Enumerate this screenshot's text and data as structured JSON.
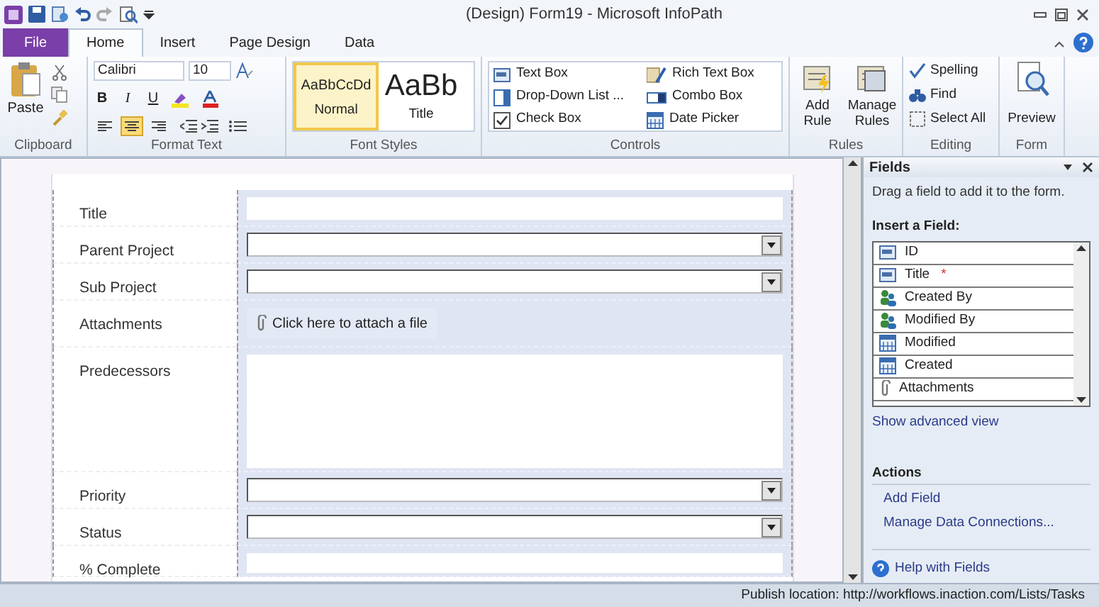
{
  "window": {
    "title": "(Design) Form19  -  Microsoft InfoPath"
  },
  "tabs": [
    {
      "label": "File",
      "kind": "file",
      "selected": false
    },
    {
      "label": "Home",
      "kind": "tab",
      "selected": true
    },
    {
      "label": "Insert",
      "kind": "tab",
      "selected": false
    },
    {
      "label": "Page Design",
      "kind": "tab",
      "selected": false
    },
    {
      "label": "Data",
      "kind": "tab",
      "selected": false
    }
  ],
  "ribbon": {
    "clipboard": {
      "label": "Clipboard",
      "paste": "Paste"
    },
    "format_text": {
      "label": "Format Text",
      "font": "Calibri",
      "size": "10",
      "bold": "B",
      "italic": "I",
      "underline": "U",
      "align": [
        {
          "kind": "left",
          "selected": false
        },
        {
          "kind": "center",
          "selected": true
        },
        {
          "kind": "right",
          "selected": false
        }
      ]
    },
    "font_styles": {
      "label": "Font Styles",
      "styles": [
        {
          "sample": "AaBbCcDd",
          "name": "Normal",
          "kind": "small",
          "selected": true
        },
        {
          "sample": "AaBb",
          "name": "Title",
          "kind": "large",
          "selected": false
        }
      ]
    },
    "controls": {
      "label": "Controls",
      "items": [
        {
          "label": "Text Box",
          "kind": "textbox"
        },
        {
          "label": "Rich Text Box",
          "kind": "richtext"
        },
        {
          "label": "Drop-Down List ...",
          "kind": "dropdown"
        },
        {
          "label": "Combo Box",
          "kind": "combo"
        },
        {
          "label": "Check Box",
          "kind": "checkbox"
        },
        {
          "label": "Date Picker",
          "kind": "date"
        }
      ]
    },
    "rules": {
      "label": "Rules",
      "add": "Add Rule",
      "manage": "Manage Rules"
    },
    "editing": {
      "label": "Editing",
      "items": [
        "Spelling",
        "Find",
        "Select All"
      ]
    },
    "form": {
      "label": "Form",
      "preview": "Preview"
    }
  },
  "form_rows": [
    {
      "label": "Title",
      "kind": "text"
    },
    {
      "label": "Parent Project",
      "kind": "dropdown"
    },
    {
      "label": "Sub Project",
      "kind": "dropdown"
    },
    {
      "label": "Attachments",
      "kind": "attachment",
      "button": "Click here to attach a file"
    },
    {
      "label": "Predecessors",
      "kind": "multiline"
    },
    {
      "label": "Priority",
      "kind": "dropdown"
    },
    {
      "label": "Status",
      "kind": "dropdown"
    },
    {
      "label": "% Complete",
      "kind": "partial"
    }
  ],
  "fields_pane": {
    "title": "Fields",
    "hint": "Drag a field to add it to the form.",
    "insert_heading": "Insert a Field:",
    "fields": [
      {
        "name": "ID",
        "kind": "text"
      },
      {
        "name": "Title",
        "kind": "text",
        "required_mark": "*"
      },
      {
        "name": "Created By",
        "kind": "person"
      },
      {
        "name": "Modified By",
        "kind": "person"
      },
      {
        "name": "Modified",
        "kind": "date"
      },
      {
        "name": "Created",
        "kind": "date"
      },
      {
        "name": "Attachments",
        "kind": "attachment"
      }
    ],
    "advanced_link": "Show advanced view",
    "actions_heading": "Actions",
    "actions": [
      "Add Field",
      "Manage Data Connections..."
    ],
    "help": "Help with Fields"
  },
  "status_bar": {
    "text": "Publish location: http://workflows.inaction.com/Lists/Tasks"
  }
}
